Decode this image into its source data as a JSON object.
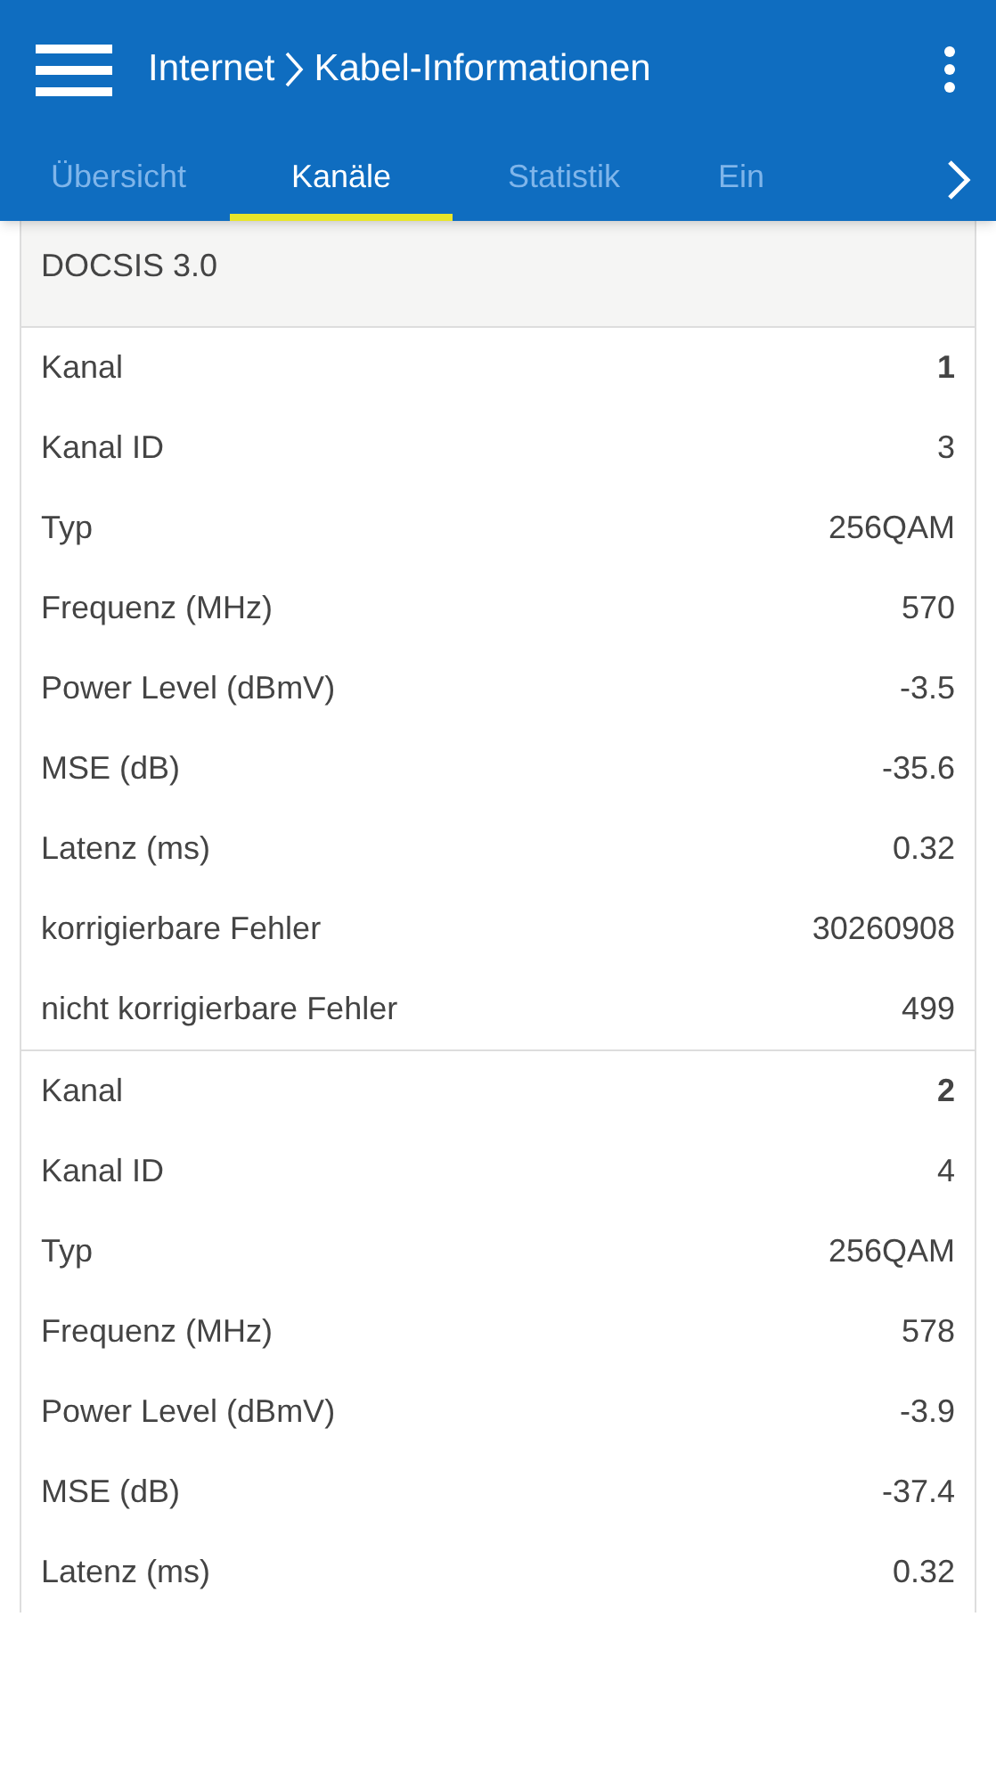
{
  "app_bar": {
    "breadcrumb": [
      "Internet",
      "Kabel-Informationen"
    ]
  },
  "tabs": [
    {
      "label": "Übersicht",
      "selected": false
    },
    {
      "label": "Kanäle",
      "selected": true
    },
    {
      "label": "Statistik",
      "selected": false
    },
    {
      "label": "Ein",
      "selected": false
    }
  ],
  "section": {
    "title": "DOCSIS 3.0"
  },
  "channels": [
    {
      "rows": [
        {
          "kind": "heading",
          "label": "Kanal",
          "value": "1"
        },
        {
          "kind": "value",
          "label": "Kanal ID",
          "value": "3"
        },
        {
          "kind": "value",
          "label": "Typ",
          "value": "256QAM"
        },
        {
          "kind": "value",
          "label": "Frequenz (MHz)",
          "value": "570"
        },
        {
          "kind": "value",
          "label": "Power Level (dBmV)",
          "value": "-3.5"
        },
        {
          "kind": "value",
          "label": "MSE (dB)",
          "value": "-35.6"
        },
        {
          "kind": "value",
          "label": "Latenz (ms)",
          "value": "0.32"
        },
        {
          "kind": "value",
          "label": "korrigierbare Fehler",
          "value": "30260908"
        },
        {
          "kind": "value",
          "label": "nicht korrigierbare Fehler",
          "value": "499"
        }
      ]
    },
    {
      "rows": [
        {
          "kind": "heading",
          "label": "Kanal",
          "value": "2"
        },
        {
          "kind": "value",
          "label": "Kanal ID",
          "value": "4"
        },
        {
          "kind": "value",
          "label": "Typ",
          "value": "256QAM"
        },
        {
          "kind": "value",
          "label": "Frequenz (MHz)",
          "value": "578"
        },
        {
          "kind": "value",
          "label": "Power Level (dBmV)",
          "value": "-3.9"
        },
        {
          "kind": "value",
          "label": "MSE (dB)",
          "value": "-37.4"
        },
        {
          "kind": "value",
          "label": "Latenz (ms)",
          "value": "0.32"
        }
      ]
    }
  ]
}
